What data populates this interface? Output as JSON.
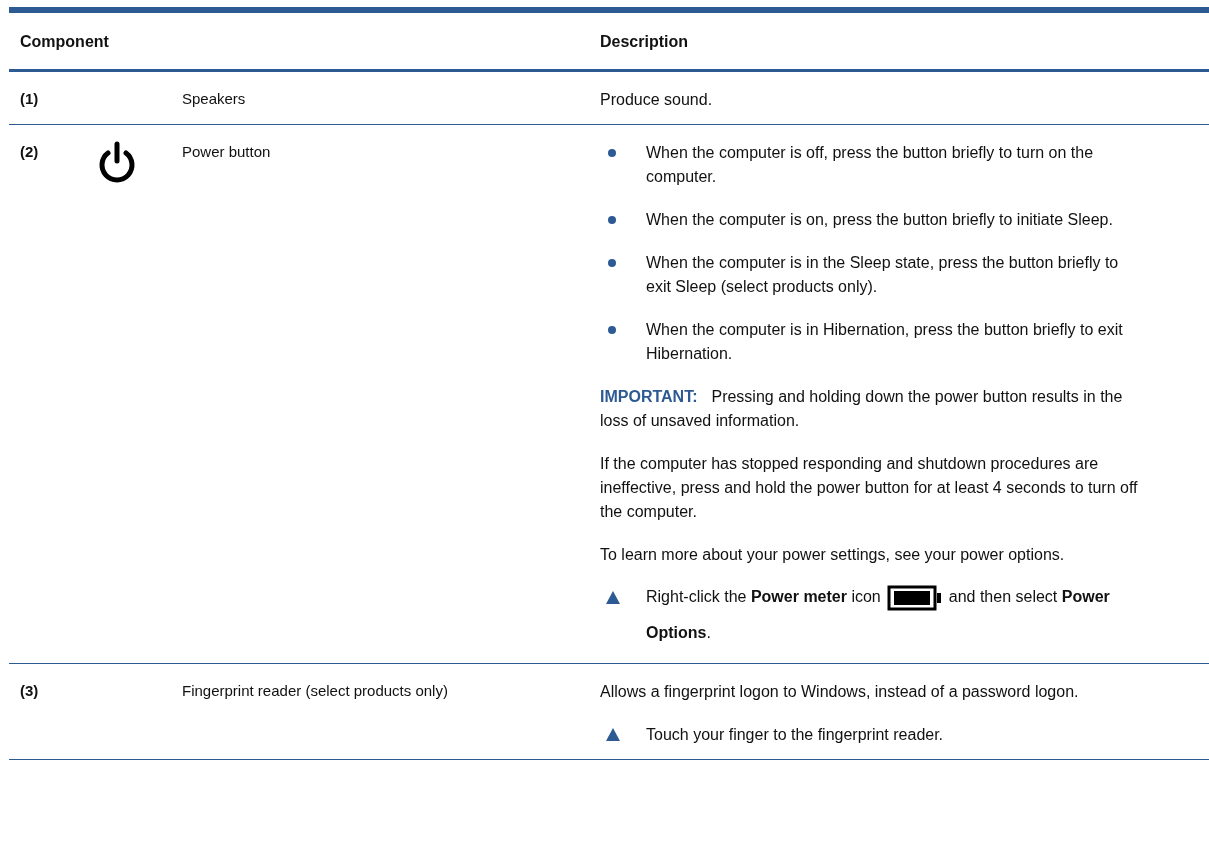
{
  "table": {
    "columns": [
      {
        "label": "Component"
      },
      {
        "label": "Description"
      }
    ],
    "rows": [
      {
        "number": "(1)",
        "name": "Speakers",
        "kind": "plain",
        "description": [
          {
            "kind": "paragraph",
            "text": "Produce sound."
          }
        ]
      },
      {
        "number": "(2)",
        "name": "Power button",
        "kind": "with_icon",
        "description": [
          {
            "kind": "bullet",
            "text": "When the computer is off, press the button briefly to turn on the computer."
          },
          {
            "kind": "bullet",
            "text": "When the computer is on, press the button briefly to initiate Sleep."
          },
          {
            "kind": "bullet",
            "text": "When the computer is in the Sleep state, press the button briefly to exit Sleep (select products only)."
          },
          {
            "kind": "bullet",
            "text": "When the computer is in Hibernation, press the button briefly to exit Hibernation."
          },
          {
            "kind": "important",
            "label": "IMPORTANT:",
            "text": "Pressing and holding down the power button results in the loss of unsaved information."
          },
          {
            "kind": "paragraph",
            "text": "If the computer has stopped responding and shutdown procedures are ineffective, press and hold the power button for at least 4 seconds to turn off the computer."
          },
          {
            "kind": "paragraph",
            "text": "To learn more about your power settings, see your power options."
          },
          {
            "kind": "step",
            "text": "Right-click the **Power meter** icon",
            "after": "and then select **Power Options**."
          }
        ]
      },
      {
        "number": "(3)",
        "name": "Fingerprint reader (select products only)",
        "kind": "plain",
        "description": [
          {
            "kind": "paragraph",
            "text": "Allows a fingerprint logon to Windows, instead of a password logon."
          },
          {
            "kind": "step",
            "text": "Touch your finger to the fingerprint reader."
          }
        ]
      }
    ]
  }
}
